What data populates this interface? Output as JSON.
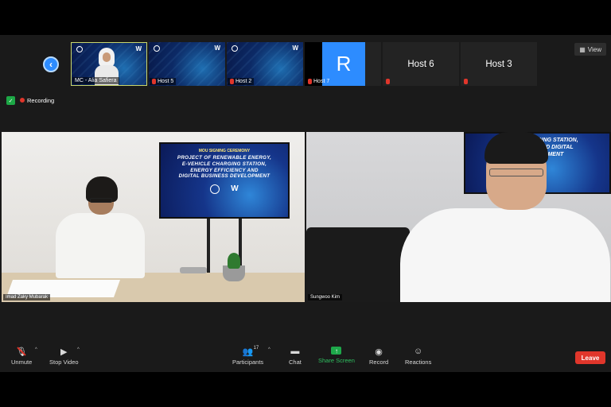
{
  "top_bar": {
    "view_label": "View",
    "back_icon": "chevron-left-icon"
  },
  "thumbnails": [
    {
      "name": "MC - Alia Safiera",
      "muted": false,
      "active": true
    },
    {
      "name": "Host 5",
      "muted": true
    },
    {
      "name": "Host 2",
      "muted": true
    },
    {
      "name": "Host 7",
      "muted": true,
      "avatar_letter": "R"
    },
    {
      "name": "Host 6",
      "muted": true
    },
    {
      "name": "Host 3",
      "muted": true
    }
  ],
  "status": {
    "recording_label": "Recording",
    "shield_icon": "shield-check-icon"
  },
  "main_video": {
    "left": {
      "name": "Imad Zaky Mubarak",
      "tv": {
        "heading": "MOU SIGNING CEREMONY",
        "title_line1": "PROJECT OF RENEWABLE ENERGY,",
        "title_line2": "E-VEHICLE CHARGING STATION,",
        "title_line3": "ENERGY EFFICIENCY AND",
        "title_line4": "DIGITAL BUSINESS DEVELOPMENT"
      }
    },
    "right": {
      "name": "Sungwoo Kim",
      "tv_text_line1": "CHARGING STATION,",
      "tv_text_line2": "ENCY AND DIGITAL",
      "tv_text_line3": "DEVELOPMENT"
    }
  },
  "controls": {
    "unmute_label": "Unmute",
    "stop_video_label": "Stop Video",
    "participants_label": "Participants",
    "participants_count": "17",
    "chat_label": "Chat",
    "share_screen_label": "Share Screen",
    "record_label": "Record",
    "reactions_label": "Reactions",
    "leave_label": "Leave"
  },
  "colors": {
    "accent": "#2d8cff",
    "share_green": "#1ea84a",
    "leave_red": "#e0362b",
    "active_border": "#c9d66c"
  }
}
